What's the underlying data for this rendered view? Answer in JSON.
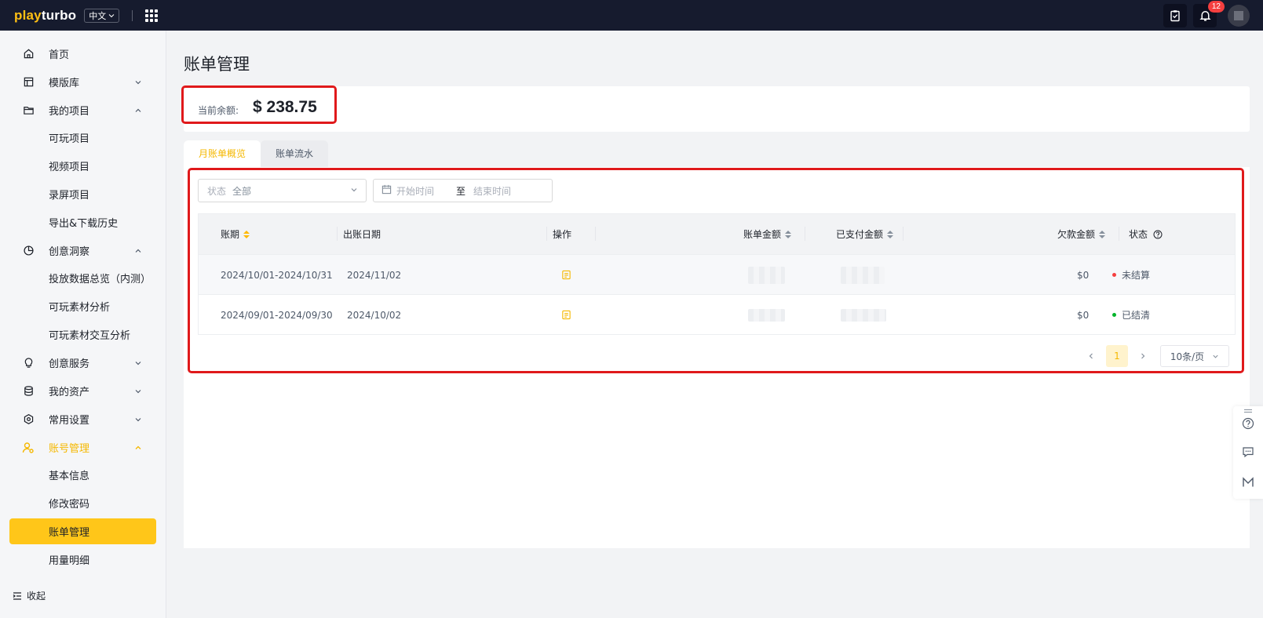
{
  "topbar": {
    "logo_prefix": "play",
    "logo_suffix": "turbo",
    "language": "中文",
    "notification_count": "12"
  },
  "sidebar": {
    "items": [
      {
        "label": "首页",
        "icon": "home-icon"
      },
      {
        "label": "模版库",
        "icon": "template-icon"
      },
      {
        "label": "我的项目",
        "icon": "folder-icon"
      },
      {
        "label": "可玩项目"
      },
      {
        "label": "视频项目"
      },
      {
        "label": "录屏项目"
      },
      {
        "label": "导出&下载历史"
      },
      {
        "label": "创意洞察",
        "icon": "pie-chart-icon"
      },
      {
        "label": "投放数据总览（内测）"
      },
      {
        "label": "可玩素材分析"
      },
      {
        "label": "可玩素材交互分析"
      },
      {
        "label": "创意服务",
        "icon": "bulb-icon"
      },
      {
        "label": "我的资产",
        "icon": "database-icon"
      },
      {
        "label": "常用设置",
        "icon": "settings-icon"
      },
      {
        "label": "账号管理",
        "icon": "user-settings-icon"
      },
      {
        "label": "基本信息"
      },
      {
        "label": "修改密码"
      },
      {
        "label": "账单管理"
      },
      {
        "label": "用量明细"
      }
    ],
    "collapse_label": "收起"
  },
  "page": {
    "title": "账单管理",
    "balance_label": "当前余额:",
    "balance_value": "$ 238.75"
  },
  "tabs": [
    {
      "label": "月账单概览"
    },
    {
      "label": "账单流水"
    }
  ],
  "filters": {
    "status_label": "状态",
    "status_value": "全部",
    "start_placeholder": "开始时间",
    "range_separator": "至",
    "end_placeholder": "结束时间"
  },
  "table": {
    "headers": {
      "period": "账期",
      "bill_date": "出账日期",
      "action": "操作",
      "bill_amount": "账单金额",
      "paid_amount": "已支付金额",
      "owed_amount": "欠款金额",
      "status": "状态"
    },
    "rows": [
      {
        "period": "2024/10/01-2024/10/31",
        "bill_date": "2024/11/02",
        "owed": "$0",
        "status": "未结算",
        "status_color": "#f53f3f"
      },
      {
        "period": "2024/09/01-2024/09/30",
        "bill_date": "2024/10/02",
        "owed": "$0",
        "status": "已结清",
        "status_color": "#00b42a"
      }
    ]
  },
  "pagination": {
    "current_page": "1",
    "page_size": "10条/页"
  },
  "colors": {
    "accent": "#ffc619",
    "highlight_box": "#e0191b",
    "topbar": "#161b2e"
  }
}
